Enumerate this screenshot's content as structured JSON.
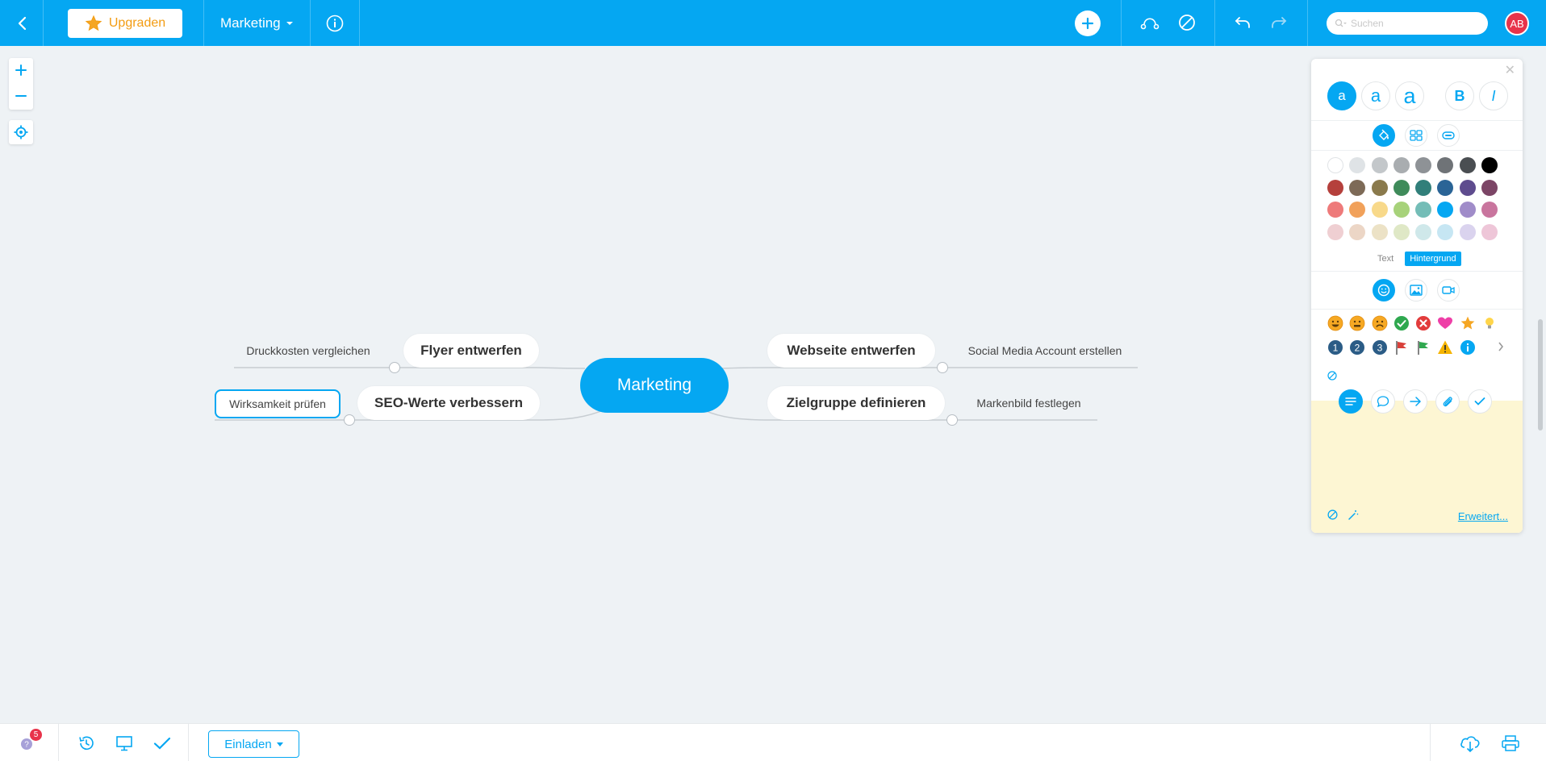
{
  "topbar": {
    "upgrade_label": "Upgraden",
    "document_title": "Marketing",
    "search_placeholder": "Suchen",
    "user_initials": "AB"
  },
  "colors": {
    "brand": "#05a7f2",
    "avatar": "#e8334a",
    "upgrade_text": "#f39c12",
    "note_background": "#fdf6d3"
  },
  "mindmap": {
    "root": "Marketing",
    "left": [
      {
        "label": "Flyer entwerfen",
        "children": [
          "Druckkosten vergleichen"
        ]
      },
      {
        "label": "SEO-Werte verbessern",
        "children": [
          "Wirksamkeit prüfen"
        ]
      }
    ],
    "right": [
      {
        "label": "Webseite entwerfen",
        "children": [
          "Social Media Account erstellen"
        ]
      },
      {
        "label": "Zielgruppe definieren",
        "children": [
          "Markenbild festlegen"
        ]
      }
    ],
    "selected_node": "Wirksamkeit prüfen"
  },
  "panel": {
    "font_sizes": [
      "a",
      "a",
      "a"
    ],
    "bold_label": "B",
    "italic_label": "I",
    "color_target_text": "Text",
    "color_target_background": "Hintergrund",
    "color_swatches": [
      "#ffffff",
      "#dfe3e6",
      "#c3c7ca",
      "#a9adb0",
      "#8e9296",
      "#6f7377",
      "#4a4e52",
      "#000000",
      "#b5403c",
      "#7d6a57",
      "#8a7a4c",
      "#3f8b5a",
      "#317f7a",
      "#2a6496",
      "#5e4c8e",
      "#7c4566",
      "#ee7a7a",
      "#f1a15a",
      "#f8d98a",
      "#a7d27a",
      "#74bdb7",
      "#05a7f2",
      "#a08cc9",
      "#c9759e",
      "#efcfd2",
      "#ecd6c6",
      "#ece2c6",
      "#dfe8c6",
      "#cfe8ea",
      "#c6e6f3",
      "#dad3ee",
      "#eec6d8"
    ],
    "icons": [
      "smiley-happy-icon",
      "smiley-neutral-icon",
      "smiley-sad-icon",
      "check-green-icon",
      "cross-red-icon",
      "heart-icon",
      "star-icon",
      "bulb-icon",
      "number-1-icon",
      "number-2-icon",
      "number-3-icon",
      "flag-red-icon",
      "flag-green-icon",
      "warning-icon",
      "info-icon"
    ],
    "number_labels": [
      "1",
      "2",
      "3"
    ],
    "note_more_label": "Erweitert..."
  },
  "bottombar": {
    "notification_count": "5",
    "invite_label": "Einladen"
  }
}
